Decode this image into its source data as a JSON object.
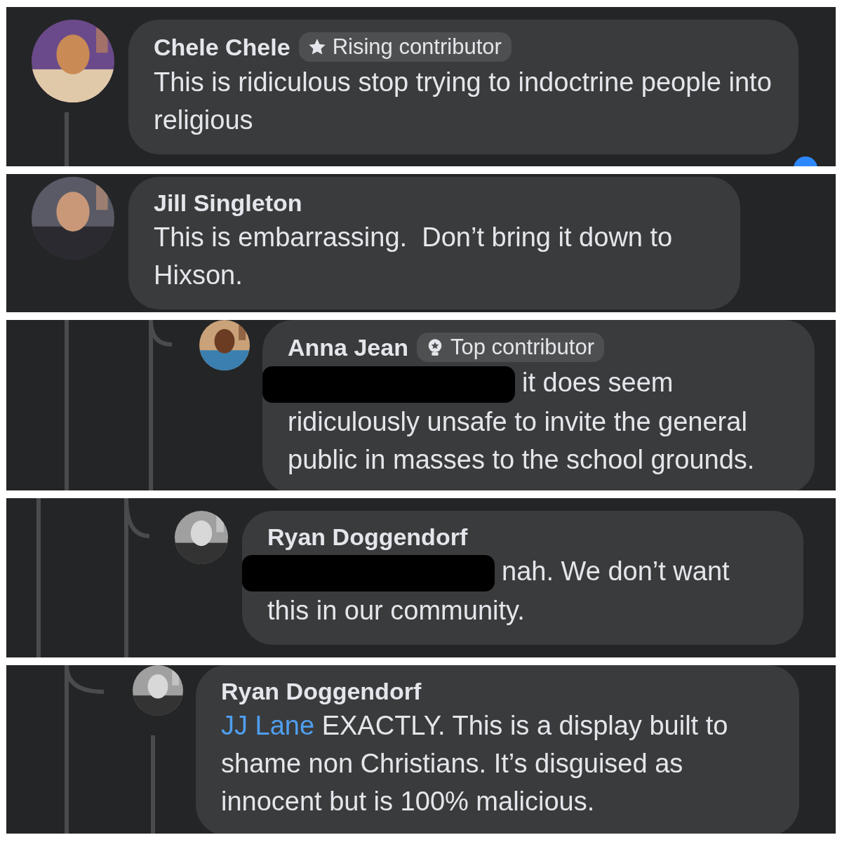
{
  "panels": [
    {
      "kind": "root",
      "author": "Chele Chele",
      "badge": {
        "kind": "star",
        "label": "Rising contributor"
      },
      "redacted": false,
      "text": "This is ridiculous stop trying to indoctrine people into religious"
    },
    {
      "kind": "root-plain",
      "author": "Jill Singleton",
      "redacted": false,
      "text": "This is embarrassing.  Don’t bring it down to Hixson."
    },
    {
      "kind": "reply",
      "author": "Anna Jean",
      "badge": {
        "kind": "medal",
        "label": "Top contributor"
      },
      "redacted": true,
      "text": "it does seem ridiculously unsafe to invite the general public in masses to the school grounds."
    },
    {
      "kind": "reply-deep",
      "author": "Ryan Doggendorf",
      "redacted": true,
      "text": "nah. We don’t want this in our community."
    },
    {
      "kind": "reply-last",
      "author": "Ryan Doggendorf",
      "redacted": false,
      "mention": "JJ Lane",
      "text": "EXACTLY. This is a display built to shame non Christians. It’s disguised as innocent but is 100% malicious."
    }
  ]
}
